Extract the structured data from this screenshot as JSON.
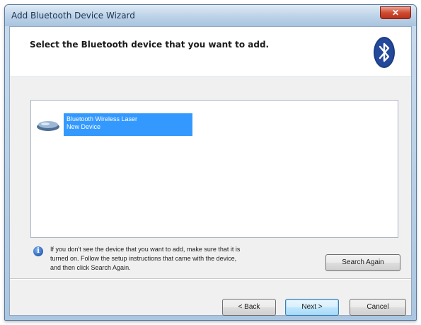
{
  "window": {
    "title": "Add Bluetooth Device Wizard",
    "close_label": "✕"
  },
  "header": {
    "heading": "Select the Bluetooth device that you want to add.",
    "logo_icon": "bluetooth-icon"
  },
  "device_list": {
    "items": [
      {
        "icon": "mouse-icon",
        "line1": "Bluetooth Wireless Laser",
        "line2": "New Device",
        "selected": true
      }
    ]
  },
  "info": {
    "icon": "info-icon",
    "lines": [
      "If you don't see the device that you want to add, make sure that it is",
      "turned on. Follow the setup instructions that came with the device,",
      "and then click Search Again."
    ]
  },
  "buttons": {
    "search_again": "Search Again",
    "back": "< Back",
    "next": "Next >",
    "cancel": "Cancel"
  },
  "colors": {
    "selection": "#3399ff",
    "bluetooth_logo": "#1b3e84"
  }
}
